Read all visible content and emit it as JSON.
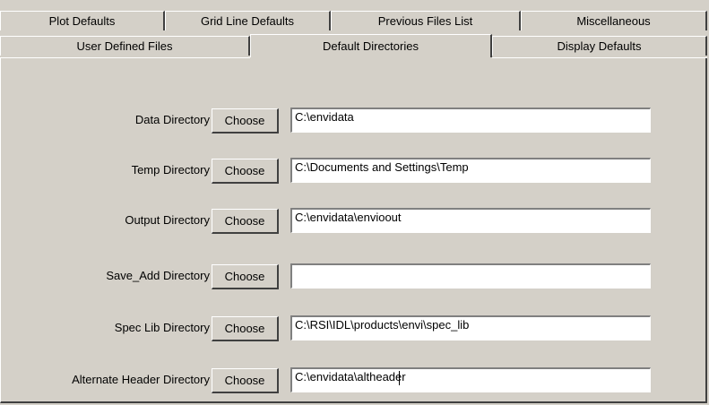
{
  "tabs": {
    "back_row": [
      {
        "label": "Plot Defaults"
      },
      {
        "label": "Grid Line Defaults"
      },
      {
        "label": "Previous Files List"
      },
      {
        "label": "Miscellaneous"
      }
    ],
    "front_row": [
      {
        "label": "User Defined Files"
      },
      {
        "label": "Default Directories",
        "active": true
      },
      {
        "label": "Display Defaults"
      }
    ]
  },
  "directories": [
    {
      "label": "Data Directory",
      "button": "Choose",
      "value": "C:\\envidata"
    },
    {
      "label": "Temp Directory",
      "button": "Choose",
      "value": "C:\\Documents and Settings\\Temp"
    },
    {
      "label": "Output Directory",
      "button": "Choose",
      "value": "C:\\envidata\\envioout"
    },
    {
      "label": "Save_Add Directory",
      "button": "Choose",
      "value": ""
    },
    {
      "label": "Spec Lib Directory",
      "button": "Choose",
      "value": "C:\\RSI\\IDL\\products\\envi\\spec_lib"
    },
    {
      "label": "Alternate Header Directory",
      "button": "Choose",
      "value": "C:\\envidata\\altheader"
    }
  ],
  "colors": {
    "face": "#d4d0c8",
    "highlight": "#ffffff",
    "shadow": "#404040",
    "field": "#ffffff"
  }
}
